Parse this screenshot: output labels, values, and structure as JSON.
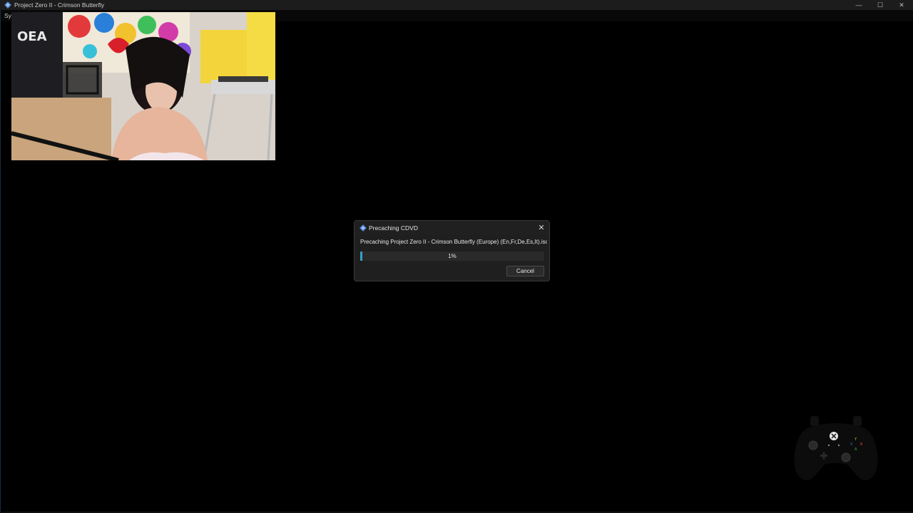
{
  "window": {
    "title": "Project Zero II - Crimson Butterfly",
    "controls": {
      "minimize": "—",
      "maximize": "☐",
      "close": "✕"
    }
  },
  "menu": {
    "first_item": "Sy"
  },
  "webcam": {
    "description_icon": "webcam-feed"
  },
  "dialog": {
    "title": "Precaching CDVD",
    "message": "Precaching Project Zero II - Crimson Butterfly (Europe) (En,Fr,De,Es,It).iso...",
    "progress_value": 0.01,
    "progress_text": "1%",
    "cancel_label": "Cancel",
    "close_glyph": "✕"
  },
  "colors": {
    "progress_accent": "#3aa0c8",
    "background": "#000000",
    "dialog_bg": "#1f1f1f"
  },
  "controller": {
    "icon": "gamepad-icon"
  }
}
